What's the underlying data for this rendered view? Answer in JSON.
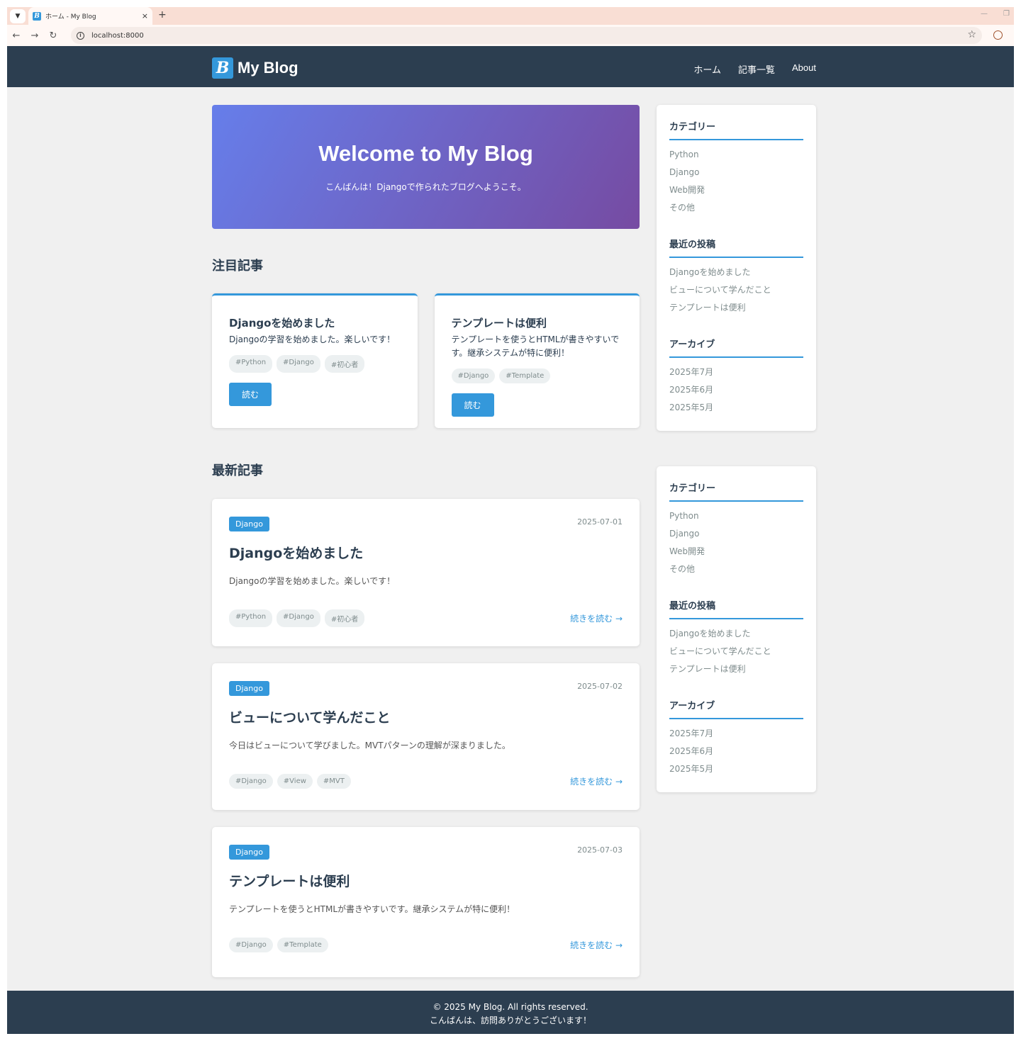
{
  "browser": {
    "tab_title": "ホーム - My Blog",
    "tab_close": "×",
    "new_tab": "+",
    "url": "localhost:8000"
  },
  "site": {
    "logo_mark": "B",
    "logo_text": "My Blog",
    "nav": [
      "ホーム",
      "記事一覧",
      "About"
    ]
  },
  "hero": {
    "title": "Welcome to My Blog",
    "subtitle": "こんばんは！Djangoで作られたブログへようこそ。"
  },
  "featured": {
    "heading": "注目記事",
    "read_label": "読む",
    "cards": [
      {
        "title": "Djangoを始めました",
        "excerpt": "Djangoの学習を始めました。楽しいです！",
        "tags": [
          "#Python",
          "#Django",
          "#初心者"
        ]
      },
      {
        "title": "テンプレートは便利",
        "excerpt": "テンプレートを使うとHTMLが書きやすいです。継承システムが特に便利！",
        "tags": [
          "#Django",
          "#Template"
        ]
      }
    ]
  },
  "latest": {
    "heading": "最新記事",
    "read_more": "続きを読む →",
    "posts": [
      {
        "category": "Django",
        "date": "2025-07-01",
        "title": "Djangoを始めました",
        "excerpt": "Djangoの学習を始めました。楽しいです！",
        "tags": [
          "#Python",
          "#Django",
          "#初心者"
        ]
      },
      {
        "category": "Django",
        "date": "2025-07-02",
        "title": "ビューについて学んだこと",
        "excerpt": "今日はビューについて学びました。MVTパターンの理解が深まりました。",
        "tags": [
          "#Django",
          "#View",
          "#MVT"
        ]
      },
      {
        "category": "Django",
        "date": "2025-07-03",
        "title": "テンプレートは便利",
        "excerpt": "テンプレートを使うとHTMLが書きやすいです。継承システムが特に便利！",
        "tags": [
          "#Django",
          "#Template"
        ]
      }
    ]
  },
  "sidebar": {
    "categories": {
      "title": "カテゴリー",
      "items": [
        "Python",
        "Django",
        "Web開発",
        "その他"
      ]
    },
    "recent": {
      "title": "最近の投稿",
      "items": [
        "Djangoを始めました",
        "ビューについて学んだこと",
        "テンプレートは便利"
      ]
    },
    "archive": {
      "title": "アーカイブ",
      "items": [
        "2025年7月",
        "2025年6月",
        "2025年5月"
      ]
    }
  },
  "footer": {
    "copyright": "© 2025 My Blog. All rights reserved.",
    "message": "こんばんは、訪問ありがとうございます！"
  },
  "colors": {
    "header_bg": "#2c3e50",
    "accent": "#3498db",
    "hero_gradient_start": "#667eea",
    "hero_gradient_end": "#764ba2"
  }
}
